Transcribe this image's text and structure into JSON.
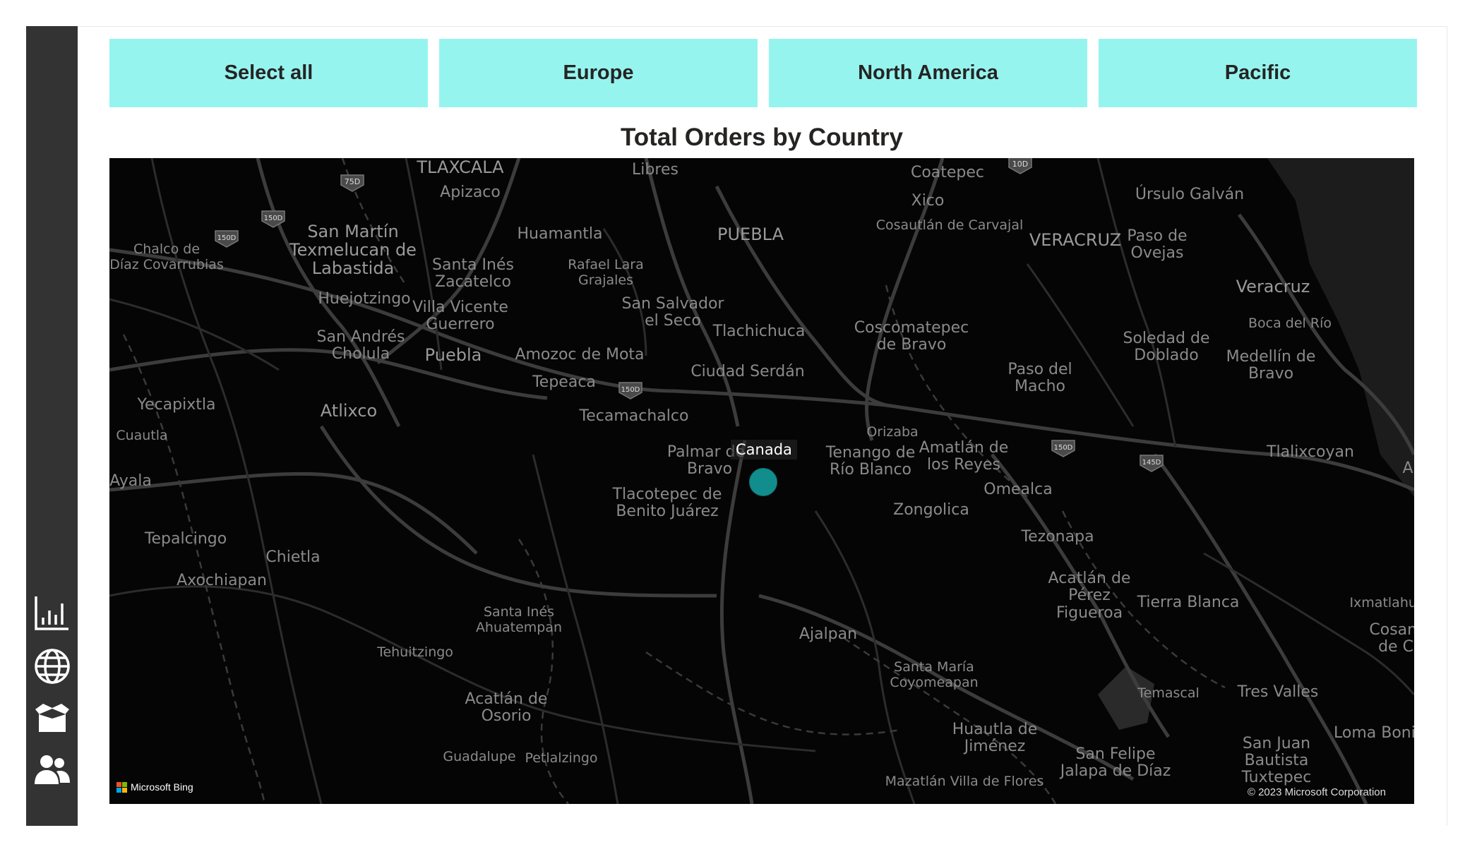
{
  "sidebar": {
    "items": [
      {
        "icon": "bar-chart-icon"
      },
      {
        "icon": "globe-icon"
      },
      {
        "icon": "box-icon"
      },
      {
        "icon": "users-icon"
      }
    ]
  },
  "slicer": {
    "buttons": [
      "Select all",
      "Europe",
      "North America",
      "Pacific"
    ],
    "color": "#96f4ef"
  },
  "chart": {
    "title": "Total Orders by Country",
    "bubble_label": "Canada",
    "bubble_color": "#118d8e",
    "attribution": "Microsoft Bing",
    "copyright": "© 2023 Microsoft Corporation"
  },
  "map_labels": {
    "tlaxcala": "TLAXCALA",
    "apizaco": "Apizaco",
    "libres": "Libres",
    "coatepec": "Coatepec",
    "xico": "Xico",
    "ursulo": "Úrsulo Galván",
    "cosautlan": "Cosautlán de Carvajal",
    "veracruz_state": "VERACRUZ",
    "paso_ovejas_1": "Paso de",
    "paso_ovejas_2": "Ovejas",
    "veracruz": "Veracruz",
    "boca": "Boca del Río",
    "soledad_1": "Soledad de",
    "soledad_2": "Doblado",
    "medellin_1": "Medellín de",
    "medellin_2": "Bravo",
    "chalco_1": "Chalco de",
    "chalco_2": "Díaz Covarrubias",
    "sanmartin_1": "San Martín",
    "sanmartin_2": "Texmelucan de",
    "sanmartin_3": "Labastida",
    "huamantla": "Huamantla",
    "puebla_state": "PUEBLA",
    "santaines_1": "Santa Inés",
    "santaines_2": "Zacatelco",
    "rafael_1": "Rafael Lara",
    "rafael_2": "Grajales",
    "huejotzingo": "Huejotzingo",
    "villa_1": "Villa Vicente",
    "villa_2": "Guerrero",
    "sansalvador_1": "San Salvador",
    "sansalvador_2": "el Seco",
    "tlachichuca": "Tlachichuca",
    "coscomatepec_1": "Coscomatepec",
    "coscomatepec_2": "de Bravo",
    "pasomacho_1": "Paso del",
    "pasomacho_2": "Macho",
    "sanandres_1": "San Andrés",
    "sanandres_2": "Cholula",
    "puebla": "Puebla",
    "amozoc": "Amozoc de Mota",
    "tepeaca": "Tepeaca",
    "ciudadserdan": "Ciudad Serdán",
    "yecapixtla": "Yecapixtla",
    "atlixco": "Atlixco",
    "tecamachalco": "Tecamachalco",
    "cuautla": "Cuautla",
    "orizaba": "Orizaba",
    "palmar_1": "Palmar de",
    "palmar_2": "Bravo",
    "tenango_1": "Tenango de",
    "tenango_2": "Río Blanco",
    "amatlan_1": "Amatlán de",
    "amatlan_2": "los Reyes",
    "tlalixcoyan": "Tlalixcoyan",
    "ayala": "Ayala",
    "tlacotepec_1": "Tlacotepec de",
    "tlacotepec_2": "Benito Juárez",
    "omealca": "Omealca",
    "zongolica": "Zongolica",
    "tepalcingo": "Tepalcingo",
    "chietla": "Chietla",
    "tezonapa": "Tezonapa",
    "axochiapan": "Axochiapan",
    "acatlanperez_1": "Acatlán de",
    "acatlanperez_2": "Pérez",
    "acatlanperez_3": "Figueroa",
    "tierrablanca": "Tierra Blanca",
    "ixmatlahua": "Ixmatlahua",
    "cosam_1": "Cosam",
    "cosam_2": "de C",
    "santaines_ahua_1": "Santa Inés",
    "santaines_ahua_2": "Ahuatempan",
    "ajalpan": "Ajalpan",
    "tehuitzingo": "Tehuitzingo",
    "santamaria_1": "Santa María",
    "santamaria_2": "Coyomeapan",
    "temascal": "Temascal",
    "tresvalles": "Tres Valles",
    "acatlanosorio_1": "Acatlán de",
    "acatlanosorio_2": "Osorio",
    "huautla_1": "Huautla de",
    "huautla_2": "Jiménez",
    "lomabonita": "Loma Bonita",
    "sanjuan_1": "San Juan",
    "sanjuan_2": "Bautista",
    "sanjuan_3": "Tuxtepec",
    "sanfelipe_1": "San Felipe",
    "sanfelipe_2": "Jalapa de Díaz",
    "guadalupe": "Guadalupe",
    "petlalzingo": "Petlalzingo",
    "mazatlan": "Mazatlán Villa de Flores",
    "edge_a1": "A",
    "edge_a2": "A",
    "shield_75d": "75D",
    "shield_150d": "150D",
    "shield_10d": "10D",
    "shield_145d": "145D"
  }
}
